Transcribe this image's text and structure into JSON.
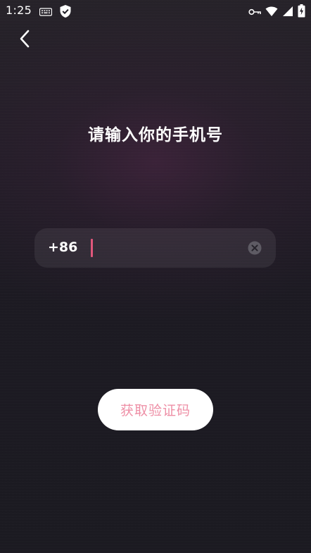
{
  "status_bar": {
    "time": "1:25",
    "left_icons": [
      "keyboard-icon",
      "shield-check-icon"
    ],
    "right_icons": [
      "vpn-key-icon",
      "wifi-icon",
      "cell-signal-icon",
      "battery-charging-icon"
    ]
  },
  "header": {
    "back_icon": "chevron-left-icon"
  },
  "title": "请输入你的手机号",
  "phone_form": {
    "country_code": "+86",
    "phone_value": "",
    "placeholder": "",
    "clear_icon": "clear-circle-icon",
    "cursor_color": "#e0577b"
  },
  "actions": {
    "get_code_label": "获取验证码"
  },
  "colors": {
    "background": "#1b1a22",
    "accent_pink": "#ee8fa6",
    "button_bg": "#ffffff"
  }
}
